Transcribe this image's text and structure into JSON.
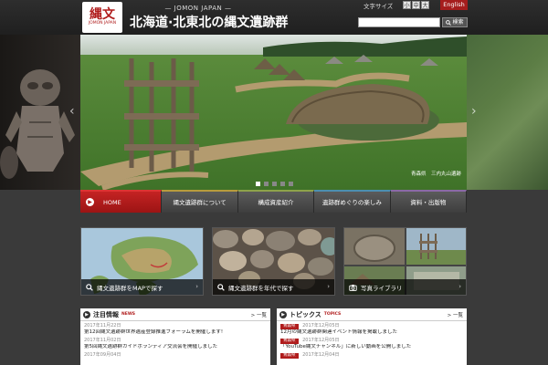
{
  "header": {
    "logo_mark": "縄文",
    "logo_sub": "JOMON JAPAN",
    "site_subtitle": "— JOMON JAPAN —",
    "site_title": "北海道·北東北の縄文遺跡群",
    "font_size_label": "文字サイズ",
    "font_size_buttons": [
      "小",
      "中",
      "大"
    ],
    "language_button": "English",
    "search": {
      "placeholder": "",
      "button_label": "検索"
    }
  },
  "hero": {
    "caption": "青森県　三内丸山遺跡",
    "slide_count": 5,
    "active_slide": 1
  },
  "nav": {
    "items": [
      {
        "label": "HOME",
        "active": true
      },
      {
        "label": "縄文遺跡群について"
      },
      {
        "label": "構成資産紹介"
      },
      {
        "label": "遺跡群めぐりの楽しみ"
      },
      {
        "label": "資料・出版物"
      }
    ]
  },
  "tiles": [
    {
      "label": "縄文遺跡群をMAPで探す"
    },
    {
      "label": "縄文遺跡群を年代で探す"
    },
    {
      "label": "写真ライブラリ"
    }
  ],
  "news": {
    "title": "注目情報",
    "title_en": "NEWS",
    "more": "> 一覧",
    "items": [
      {
        "date": "2017年11月22日",
        "text": "第12回縄文遺跡群世界遺産登録推進フォーラムを開催します!"
      },
      {
        "date": "2017年11月02日",
        "text": "第5回縄文遺跡群ガイドボランティア交流会を開催しました"
      },
      {
        "date": "2017年09月04日",
        "text": ""
      }
    ]
  },
  "topics": {
    "title": "トピックス",
    "title_en": "TOPICS",
    "more": "> 一覧",
    "items": [
      {
        "tag": "青森県",
        "date": "2017年12月05日",
        "text": "12月の縄文遺跡群関連イベント情報を掲載しました"
      },
      {
        "tag": "青森県",
        "date": "2017年12月05日",
        "text": "「YouTube縄文チャンネル」に新しい動画を公開しました"
      },
      {
        "tag": "青森県",
        "date": "2017年12月04日",
        "text": ""
      }
    ]
  },
  "colors": {
    "accent_red": "#b01c1c",
    "header_bg": "#1f1f1f",
    "page_bg": "#3a3a3a"
  }
}
